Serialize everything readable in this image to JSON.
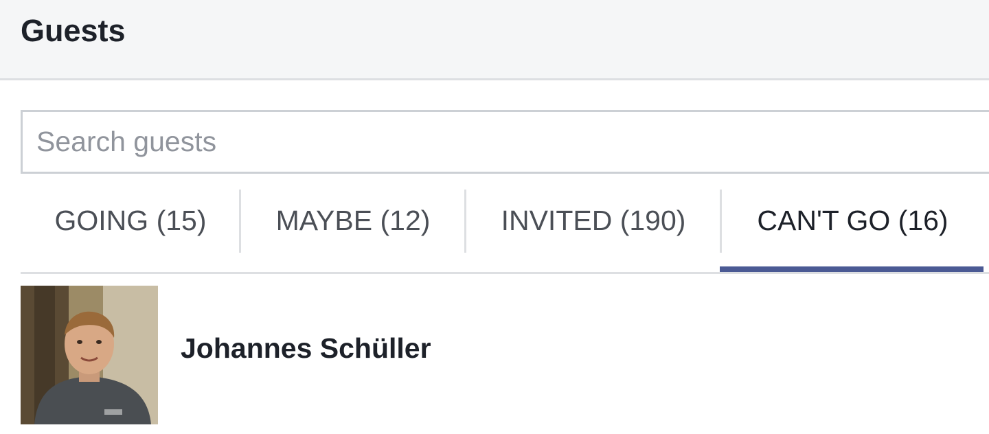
{
  "header": {
    "title": "Guests"
  },
  "search": {
    "placeholder": "Search guests",
    "value": ""
  },
  "tabs": [
    {
      "label": "GOING (15)",
      "active": false
    },
    {
      "label": "MAYBE (12)",
      "active": false
    },
    {
      "label": "INVITED (190)",
      "active": false
    },
    {
      "label": "CAN'T GO (16)",
      "active": true
    }
  ],
  "guests": [
    {
      "name": "Johannes Schüller",
      "avatar": "guest-photo"
    }
  ],
  "colors": {
    "active_tab_underline": "#4b5a94",
    "header_background": "#f5f6f7",
    "border": "#dddfe2"
  }
}
